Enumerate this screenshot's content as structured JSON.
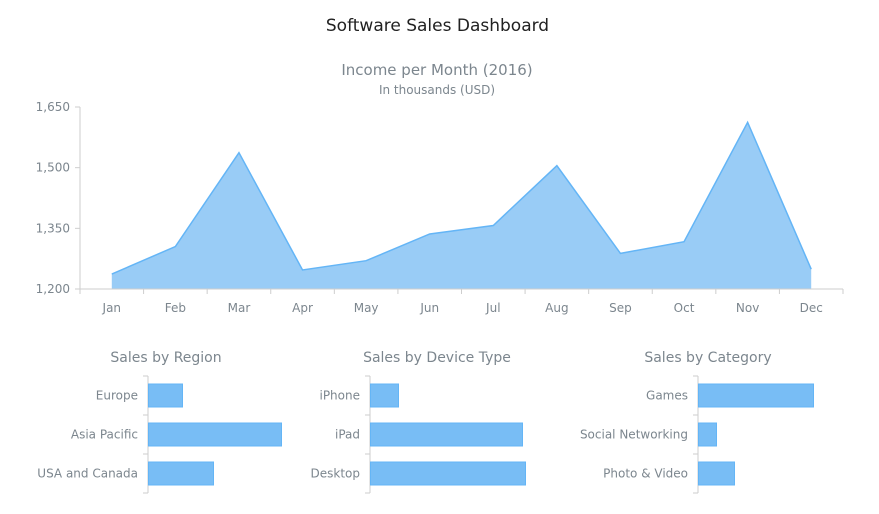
{
  "dashboard": {
    "title": "Software Sales Dashboard"
  },
  "colors": {
    "area_fill": "#99CCF6",
    "area_stroke": "#64B5F6",
    "bar_fill": "#78BDF5",
    "bar_stroke": "#64B5F6",
    "axis": "#CECECE",
    "text": "#7C868E"
  },
  "chart_data": [
    {
      "type": "area",
      "title": "Income per Month (2016)",
      "subtitle": "In thousands (USD)",
      "xlabel": "",
      "ylabel": "",
      "categories": [
        "Jan",
        "Feb",
        "Mar",
        "Apr",
        "May",
        "Jun",
        "Jul",
        "Aug",
        "Sep",
        "Oct",
        "Nov",
        "Dec"
      ],
      "values": [
        1237,
        1305,
        1537,
        1247,
        1270,
        1336,
        1357,
        1505,
        1288,
        1317,
        1612,
        1249
      ],
      "ylim": [
        1200,
        1650
      ],
      "yticks": [
        1200,
        1350,
        1500,
        1650
      ],
      "ytick_labels": [
        "1,200",
        "1,350",
        "1,500",
        "1,650"
      ],
      "grid": false,
      "legend": "none"
    },
    {
      "type": "bar",
      "orientation": "horizontal",
      "title": "Sales by Region",
      "categories": [
        "Europe",
        "Asia Pacific",
        "USA and Canada"
      ],
      "values": [
        34,
        133,
        65
      ],
      "xlim": [
        0,
        140
      ],
      "grid": false,
      "legend": "none"
    },
    {
      "type": "bar",
      "orientation": "horizontal",
      "title": "Sales by Device Type",
      "categories": [
        "iPhone",
        "iPad",
        "Desktop"
      ],
      "values": [
        28,
        152,
        155
      ],
      "xlim": [
        0,
        160
      ],
      "grid": false,
      "legend": "none"
    },
    {
      "type": "bar",
      "orientation": "horizontal",
      "title": "Sales by Category",
      "categories": [
        "Games",
        "Social Networking",
        "Photo & Video"
      ],
      "values": [
        115,
        18,
        36
      ],
      "xlim": [
        0,
        120
      ],
      "grid": false,
      "legend": "none"
    }
  ]
}
